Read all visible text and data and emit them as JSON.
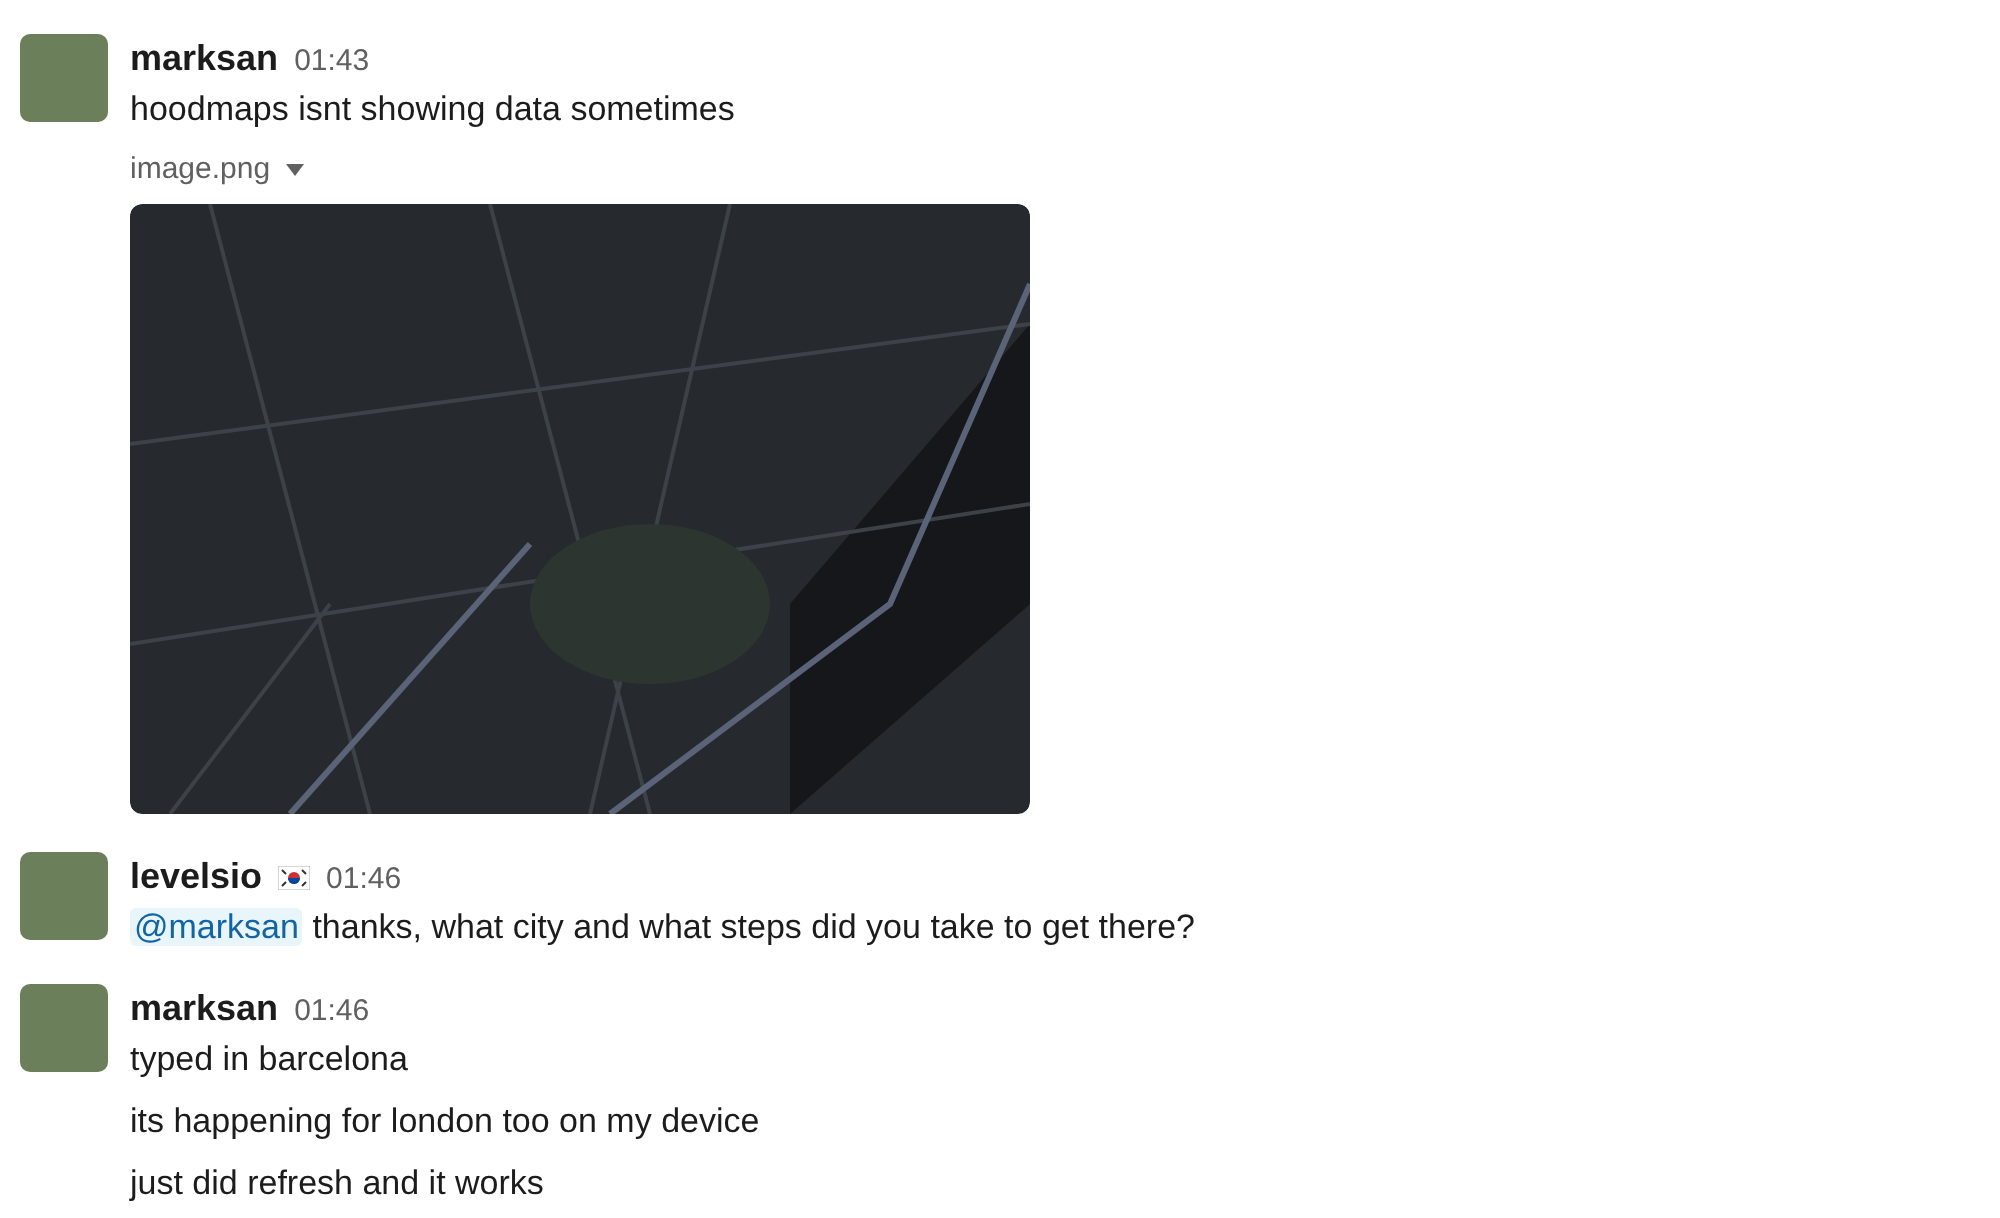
{
  "messages": [
    {
      "author": "marksan",
      "flag_icon": false,
      "time": "01:43",
      "lines": [
        {
          "text": "hoodmaps isnt showing data sometimes"
        }
      ],
      "attachment": {
        "filename": "image.png"
      }
    },
    {
      "author": "levelsio",
      "flag_icon": true,
      "time": "01:46",
      "lines": [
        {
          "mention": "@marksan",
          "text": "thanks, what city and what steps did you take to get there?"
        }
      ]
    },
    {
      "author": "marksan",
      "flag_icon": false,
      "time": "01:46",
      "lines": [
        {
          "text": "typed in barcelona"
        },
        {
          "text": "its happening for london too on my device"
        },
        {
          "text": "just did refresh and it works"
        }
      ]
    }
  ]
}
